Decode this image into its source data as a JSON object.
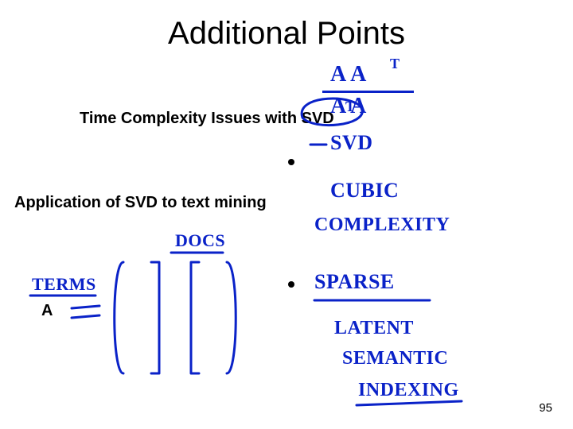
{
  "title": "Additional Points",
  "subheading1": "Time Complexity Issues with SVD",
  "subheading2": "Application of SVD to text mining",
  "letterA": "A",
  "pageNumber": "95",
  "annotations": {
    "aat_top": "A A",
    "superscript_T": "T",
    "aat_bottom": "A  A",
    "superscript_T2": "T",
    "svd": "SVD",
    "cubic": "CUBIC",
    "complexity": "COMPLEXITY",
    "sparse": "SPARSE",
    "latent": "LATENT",
    "semantic": "SEMANTIC",
    "indexing": "INDEXING",
    "docs": "DOCS",
    "terms": "TERMS"
  }
}
